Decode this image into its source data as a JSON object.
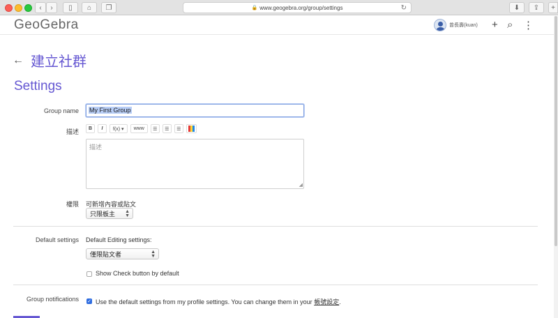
{
  "browser": {
    "url": "www.geogebra.org/group/settings",
    "back_glyph": "‹",
    "forward_glyph": "›",
    "sidebar_glyph": "▯",
    "home_glyph": "⌂",
    "tabs_glyph": "❐",
    "download_glyph": "⬇",
    "share_glyph": "⇪",
    "new_tab_glyph": "+"
  },
  "app": {
    "logo": "GeoGebra",
    "user_name": "曾長壽(kuan)",
    "add_glyph": "+",
    "search_glyph": "⌕",
    "more_glyph": "⋮"
  },
  "page": {
    "back_arrow": "←",
    "back_label": "建立社群",
    "title": "Settings"
  },
  "form": {
    "group_name_label": "Group name",
    "group_name_value": "My First Group",
    "description_label": "描述",
    "description_placeholder": "描述",
    "toolbar": {
      "bold": "B",
      "italic": "I",
      "formula": "f(x) ▾",
      "link": "www",
      "list1": "☰",
      "list2": "☰",
      "list3": "☰"
    },
    "permission_label": "權限",
    "permission_text": "可新增內容或貼文",
    "permission_value": "只限板主",
    "default_settings_label": "Default settings",
    "default_editing_label": "Default Editing settings:",
    "default_editing_value": "僅限貼文者",
    "show_check_label": "Show Check button by default",
    "notifications_label": "Group notifications",
    "notifications_text": "Use the default settings from my profile settings. You can change them in your",
    "account_link": "帳號設定",
    "period": "."
  },
  "colors": {
    "accent": "#6557d2",
    "checkbox": "#2f6de0"
  }
}
